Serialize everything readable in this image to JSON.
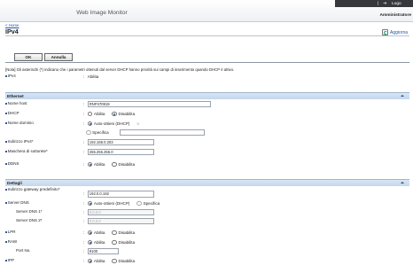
{
  "header": {
    "app_title": "Web Image Monitor",
    "top_right_text": "Logo",
    "admin_label": "Amministratore"
  },
  "breadcrumb": {
    "home": "< Home"
  },
  "page": {
    "title": "IPv4",
    "update_label": "Aggiorna"
  },
  "buttons": {
    "ok": "OK",
    "cancel": "Annulla"
  },
  "note": "[Nota] Gli asterischi (*) indicano che i parametri ottenuti dal server DHCP hanno priorità sui campi di inserimento quando DHCP è attivo.",
  "ipv4": {
    "label": "IPv4",
    "value": "Abilita"
  },
  "ethernet": {
    "title": "Ethernet",
    "host_name": {
      "label": "Nome host",
      "value": "RNP470919"
    },
    "dhcp": {
      "label": "DHCP",
      "opt_on": "Abilita",
      "opt_off": "Disabilita"
    },
    "domain": {
      "label": "Nome dominio",
      "opt_auto": "Auto-ottieni (DHCP)",
      "opt_specify": "Specifica",
      "value": ""
    },
    "ipv4_address": {
      "label": "Indirizzo IPv4*",
      "value": "192.168.0.203"
    },
    "subnet": {
      "label": "Maschera di sottorete*",
      "value": "255.255.255.0"
    },
    "ddns": {
      "label": "DDNS",
      "opt_on": "Abilita",
      "opt_off": "Disabilita"
    }
  },
  "settings": {
    "title": "Dettagli",
    "gateway": {
      "label": "Indirizzo gateway predefinito*",
      "value": "192.0.0.192"
    },
    "dns_server": {
      "label": "Server DNS",
      "opt_auto": "Auto-ottieni (DHCP)",
      "opt_specify": "Specifica"
    },
    "dns1": {
      "label": "Server DNS 1*",
      "value": "0.0.0.0"
    },
    "dns2": {
      "label": "Server DNS 2*",
      "value": "0.0.0.0"
    },
    "lpr": {
      "label": "LPR",
      "opt_on": "Abilita",
      "opt_off": "Disabilita"
    },
    "raw": {
      "label": "RAW",
      "opt_on": "Abilita",
      "opt_off": "Disabilita"
    },
    "port": {
      "label": "Port No.",
      "value": "9100"
    },
    "ipp": {
      "label": "IPP",
      "opt_on": "Abilita",
      "opt_off": "Disabilita"
    }
  }
}
